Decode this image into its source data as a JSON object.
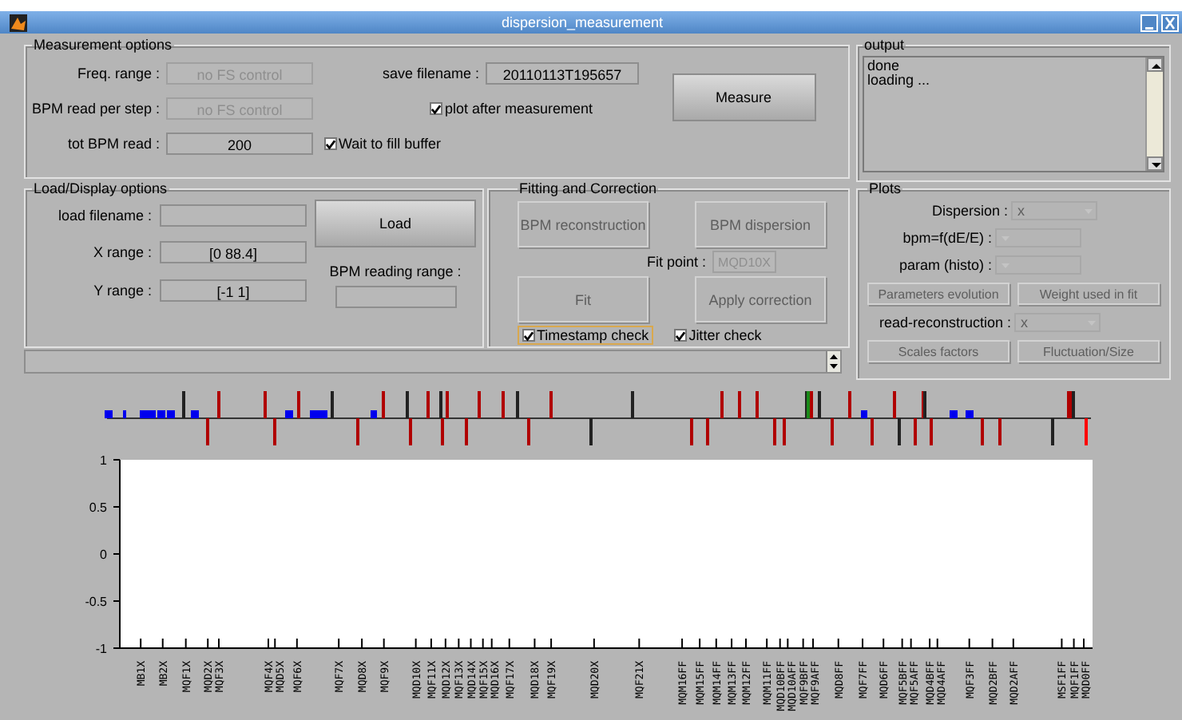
{
  "window": {
    "title": "dispersion_measurement"
  },
  "measurement_options": {
    "title": "Measurement options",
    "fields": [
      {
        "label": "Freq. range :",
        "value": "no FS control",
        "disabled": true
      },
      {
        "label": "BPM read per step :",
        "value": "no FS control",
        "disabled": true
      },
      {
        "label": "tot BPM read :",
        "value": "200",
        "disabled": false
      }
    ],
    "save_filename": {
      "label": "save filename :",
      "value": "20110113T195657"
    },
    "checkboxes": [
      {
        "label": "plot after measurement",
        "checked": true
      },
      {
        "label": "Wait to fill buffer",
        "checked": true
      }
    ],
    "button": {
      "label": "Measure",
      "disabled": false
    }
  },
  "load_display_options": {
    "title": "Load/Display options",
    "fields": [
      {
        "label": "load filename :"
      },
      {
        "label": "X range :",
        "value": "[0 88.4]"
      },
      {
        "label": "Y range :",
        "value": "[-1 1]"
      }
    ],
    "button": {
      "label": "Load",
      "disabled": false
    },
    "bpm_reading_range": {
      "label": "BPM reading range :"
    }
  },
  "fitting_and_correction": {
    "title": "Fitting and Correction",
    "buttons": [
      {
        "label": "BPM reconstruction",
        "disabled": true
      },
      {
        "label": "BPM dispersion",
        "disabled": true
      }
    ],
    "fit_point": {
      "label": "Fit point :",
      "value": "MQD10X",
      "disabled": true
    },
    "buttons_2": [
      {
        "label": "Fit",
        "disabled": true
      },
      {
        "label": "Apply correction",
        "disabled": true
      }
    ],
    "checkboxes": [
      {
        "label": "Timestamp check",
        "checked": true,
        "focused": true
      },
      {
        "label": "Jitter check",
        "checked": true,
        "focused": false
      }
    ]
  },
  "output": {
    "title": "output",
    "lines": [
      "done",
      "loading ..."
    ]
  },
  "plots": {
    "title": "Plots",
    "dropdowns": [
      {
        "label": "Dispersion :",
        "value": "x",
        "disabled": true
      },
      {
        "label": "bpm=f(dE/E) :",
        "disabled": true
      },
      {
        "label": "param (histo) :",
        "disabled": true
      }
    ],
    "buttons": [
      {
        "label": "Parameters evolution",
        "disabled": true
      },
      {
        "label": "Weight used in fit",
        "disabled": true
      }
    ],
    "read_reconstruction": {
      "label": "read-reconstruction :",
      "value": "x",
      "disabled": true
    },
    "buttons_2": [
      {
        "label": "Scales factors",
        "disabled": true
      },
      {
        "label": "Fluctuation/Size",
        "disabled": true
      }
    ]
  },
  "chart_data": {
    "type": "line",
    "ylim": [
      -1,
      1
    ],
    "yticks": [
      1,
      0.5,
      0,
      -0.5,
      -1
    ],
    "categories": [
      "MB1X",
      "MB2X",
      "MQF1X",
      "MQD2X",
      "MQF3X",
      "MQF4X",
      "MQD5X",
      "MQF6X",
      "MQF7X",
      "MQD8X",
      "MQF9X",
      "MQD10X",
      "MQF11X",
      "MQD12X",
      "MQF13X",
      "MQD14X",
      "MQF15X",
      "MQD16X",
      "MQF17X",
      "MQD18X",
      "MQF19X",
      "MQD20X",
      "MQF21X",
      "MQM16FF",
      "MQM15FF",
      "MQM14FF",
      "MQM13FF",
      "MQM12FF",
      "MQM11FF",
      "MQD10BFF",
      "MQD10AFF",
      "MQF9BFF",
      "MQF9AFF",
      "MQD8FF",
      "MQF7FF",
      "MQD6FF",
      "MQF5BFF",
      "MQF5AFF",
      "MQD4BFF",
      "MQD4AFF",
      "MQF3FF",
      "MQD2BFF",
      "MQD2AFF",
      "MSF1FF",
      "MQF1FF",
      "MQD0FF"
    ]
  }
}
